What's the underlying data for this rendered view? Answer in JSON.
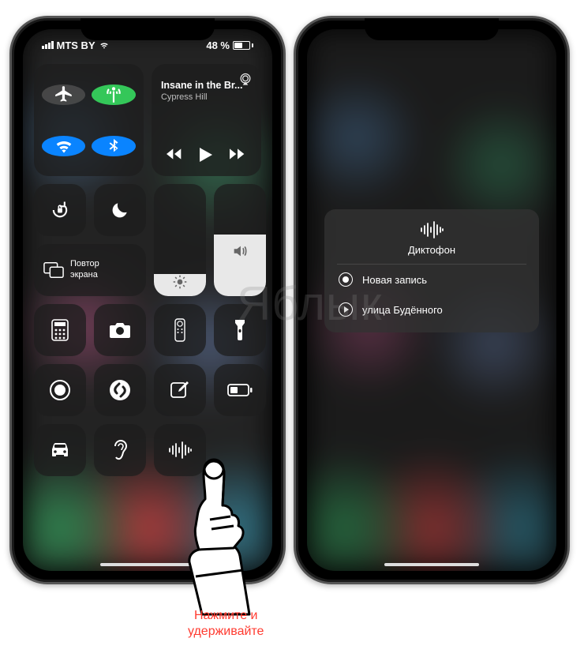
{
  "statusbar": {
    "carrier": "MTS BY",
    "battery_pct": "48 %",
    "battery_fill_pct": 48
  },
  "media": {
    "song_title": "Insane in the Br...",
    "artist": "Cypress Hill"
  },
  "screen_mirror_label": "Повтор\nэкрана",
  "brightness_pct": 20,
  "volume_pct": 55,
  "context_menu": {
    "title": "Диктофон",
    "new_recording": "Новая запись",
    "recent": "улица Будённого"
  },
  "caption": {
    "line1": "Нажмите и",
    "line2": "удерживайте"
  },
  "watermark": "Яблык"
}
